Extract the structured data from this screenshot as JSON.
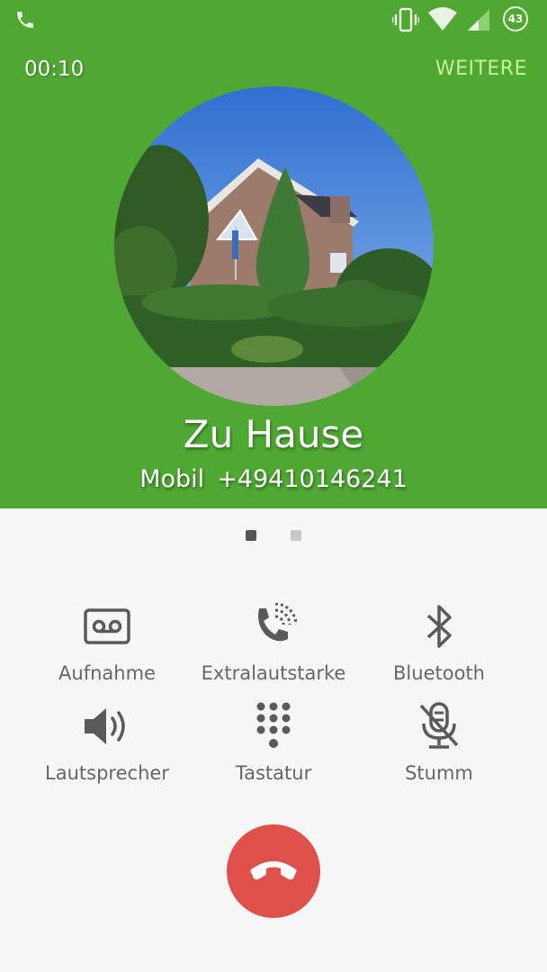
{
  "status_bar": {
    "call_icon": "phone-icon",
    "vibrate_icon": "vibrate-icon",
    "wifi_icon": "wifi-icon",
    "signal_icon": "signal-icon",
    "battery_level": "43"
  },
  "call": {
    "timer": "00:10",
    "more_label": "WEITERE"
  },
  "contact": {
    "name": "Zu Hause",
    "number_type": "Mobil",
    "number": "+49410146241",
    "photo_icon": "contact-photo-house"
  },
  "pager": {
    "active_index": 0,
    "count": 2
  },
  "actions": [
    {
      "label": "Aufnahme",
      "icon": "record-icon"
    },
    {
      "label": "Extralautstarke",
      "icon": "extra-volume-icon"
    },
    {
      "label": "Bluetooth",
      "icon": "bluetooth-icon"
    },
    {
      "label": "Lautsprecher",
      "icon": "speaker-icon"
    },
    {
      "label": "Tastatur",
      "icon": "keypad-icon"
    },
    {
      "label": "Stumm",
      "icon": "mute-icon"
    }
  ],
  "end_call": {
    "icon": "end-call-icon",
    "color": "#e0504a"
  },
  "colors": {
    "header": "#4ea832",
    "accent_text": "#c5f19b",
    "background": "#f7f7f7",
    "icon": "#5a5a5a"
  }
}
